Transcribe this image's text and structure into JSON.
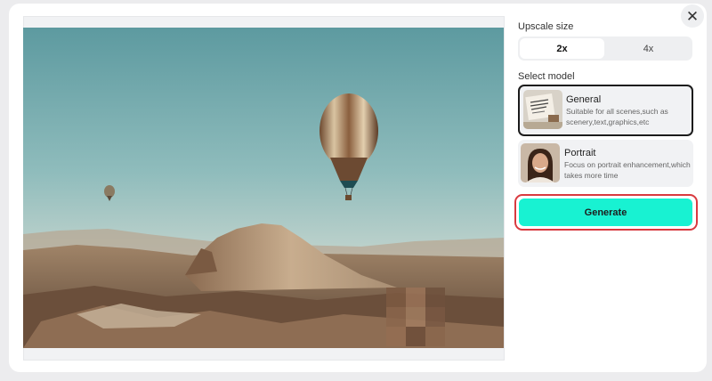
{
  "dialog": {
    "close_icon": "close-icon",
    "close_glyph": "✕"
  },
  "upscale": {
    "label": "Upscale size",
    "options": [
      {
        "label": "2x",
        "selected": true
      },
      {
        "label": "4x",
        "selected": false
      }
    ]
  },
  "model": {
    "label": "Select model",
    "options": [
      {
        "name": "General",
        "description": "Suitable for all scenes,such as scenery,text,graphics,etc",
        "selected": true
      },
      {
        "name": "Portrait",
        "description": "Focus on portrait enhancement,which takes more time",
        "selected": false
      }
    ]
  },
  "generate": {
    "label": "Generate",
    "color": "#18f2d2",
    "highlight_color": "#d93a3f"
  }
}
